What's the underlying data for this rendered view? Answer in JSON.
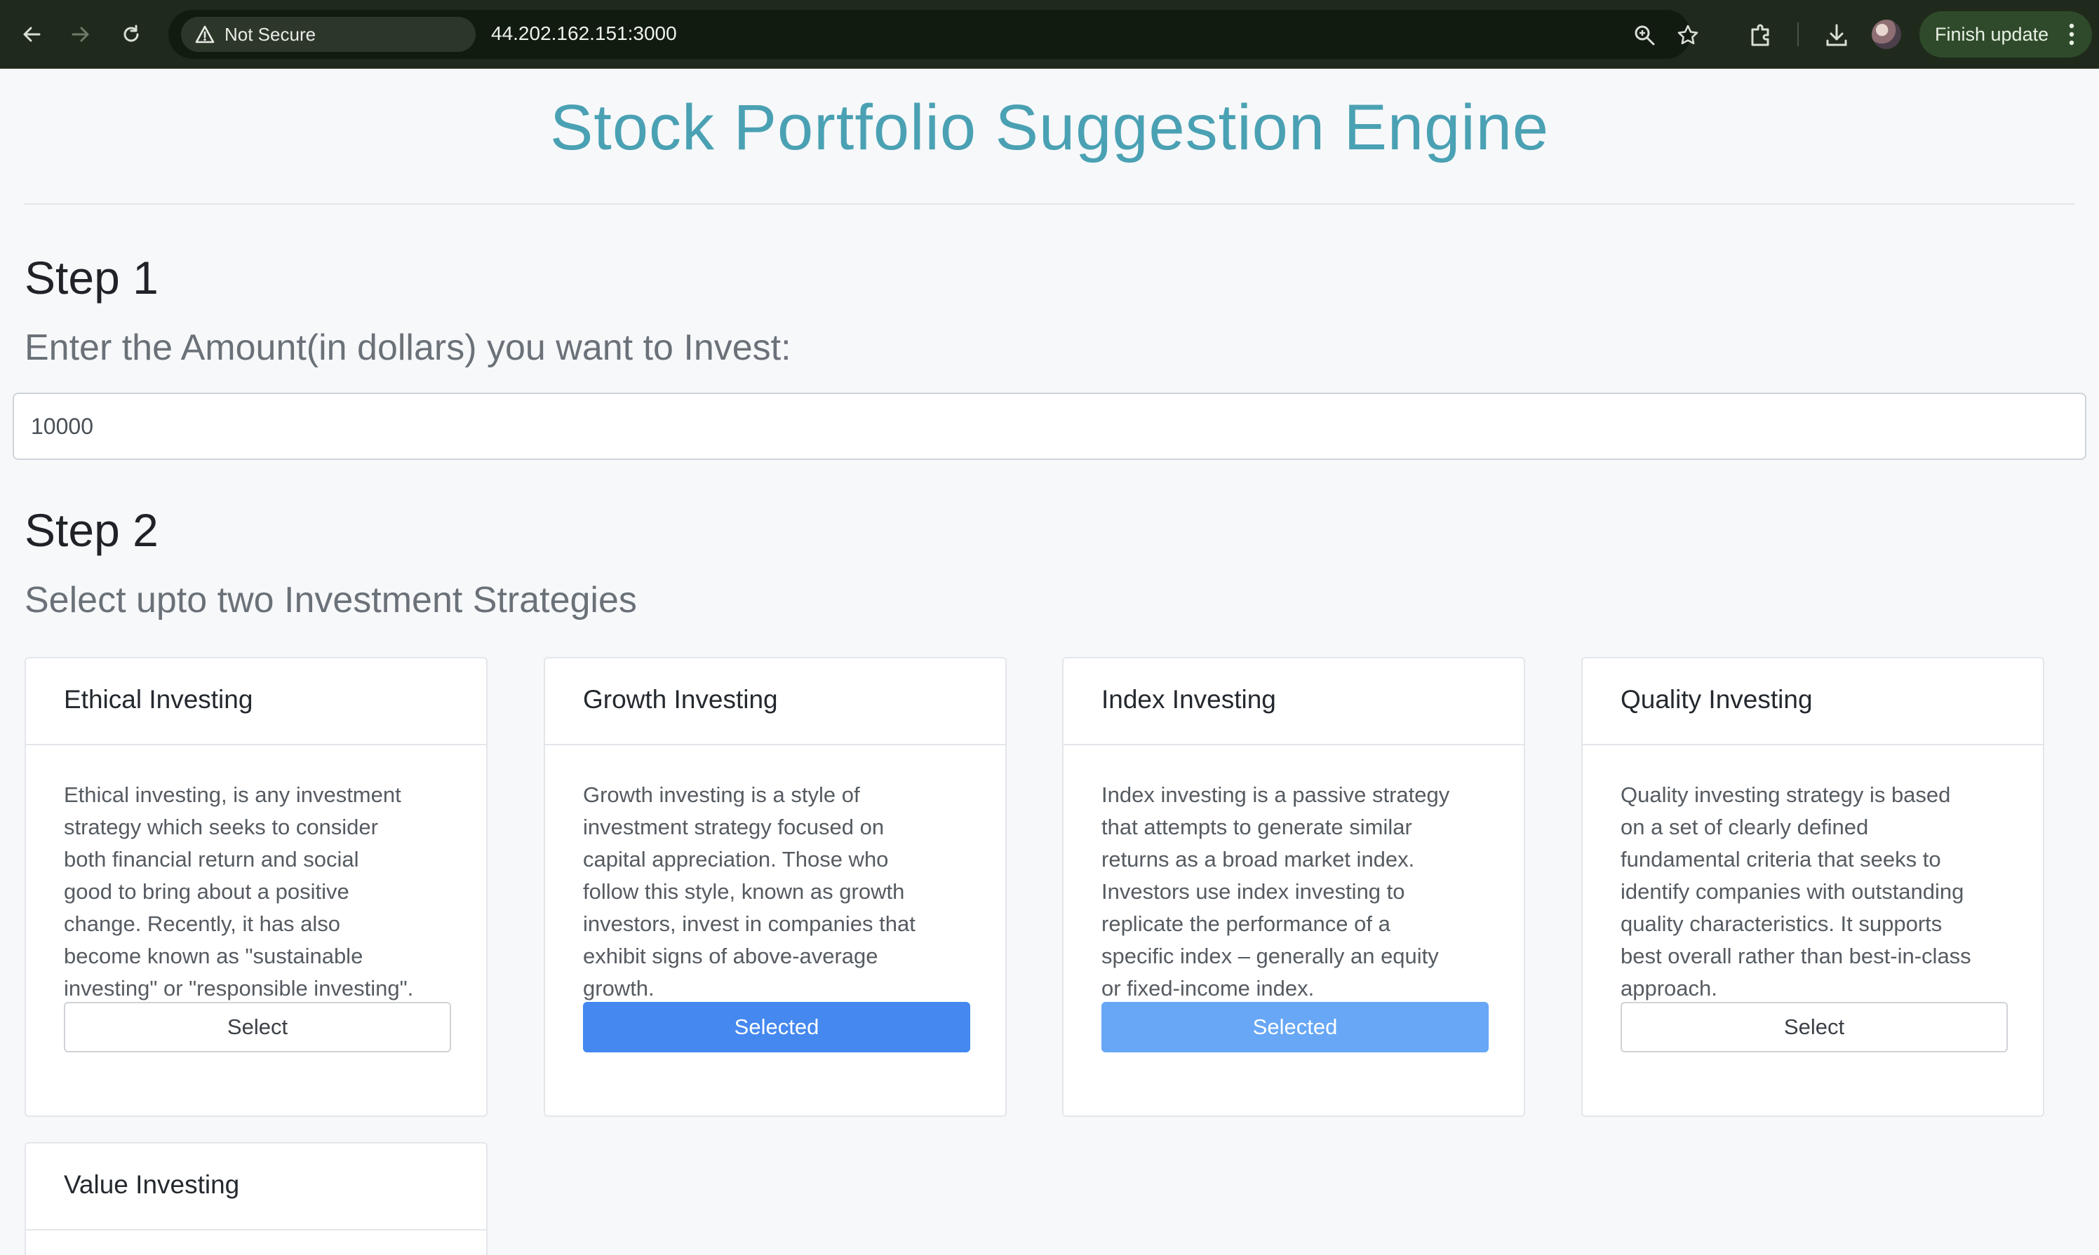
{
  "browser": {
    "security_label": "Not Secure",
    "url": "44.202.162.151:3000",
    "update_label": "Finish update"
  },
  "page": {
    "title": "Stock Portfolio Suggestion Engine",
    "step1": {
      "heading": "Step 1",
      "prompt": "Enter the Amount(in dollars) you want to Invest:",
      "amount_value": "10000"
    },
    "step2": {
      "heading": "Step 2",
      "prompt": "Select upto two Investment Strategies"
    }
  },
  "strategies": [
    {
      "title": "Ethical Investing",
      "lines": [
        "Ethical investing, is any investment",
        "strategy which seeks to consider",
        "both financial return and social",
        "good to bring about a positive",
        "change. Recently, it has also",
        "become known as \"sustainable",
        "investing\" or \"responsible investing\"."
      ],
      "button": "Select",
      "state": "unselected"
    },
    {
      "title": "Growth Investing",
      "lines": [
        "Growth investing is a style of",
        "investment strategy focused on",
        "capital appreciation. Those who",
        "follow this style, known as growth",
        "investors, invest in companies that",
        "exhibit signs of above-average",
        "growth."
      ],
      "button": "Selected",
      "state": "selected"
    },
    {
      "title": "Index Investing",
      "lines": [
        "Index investing is a passive strategy",
        "that attempts to generate similar",
        "returns as a broad market index.",
        "Investors use index investing to",
        "replicate the performance of a",
        "specific index – generally an equity",
        "or fixed-income index."
      ],
      "button": "Selected",
      "state": "selected-hover"
    },
    {
      "title": "Quality Investing",
      "lines": [
        "Quality investing strategy is based",
        "on a set of clearly defined",
        "fundamental criteria that seeks to",
        "identify companies with outstanding",
        "quality characteristics. It supports",
        "best overall rather than best-in-class",
        "approach."
      ],
      "button": "Select",
      "state": "unselected"
    },
    {
      "title": "Value Investing",
      "lines": [],
      "button": "",
      "state": "unselected"
    }
  ],
  "colors": {
    "title": "#4aa1b3",
    "primary_button": "#4488f0",
    "primary_button_hover": "#67a7f5"
  }
}
